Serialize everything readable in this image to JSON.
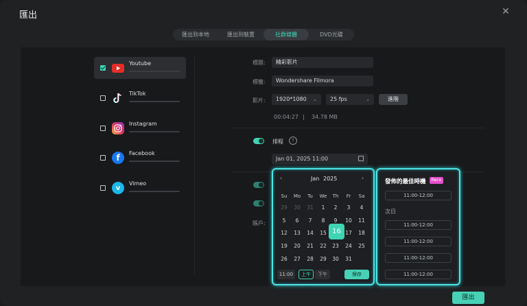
{
  "dialog": {
    "title": "匯出"
  },
  "tabs": [
    {
      "label": "匯出到本地"
    },
    {
      "label": "匯出到裝置"
    },
    {
      "label": "社群媒體"
    },
    {
      "label": "DVD光碟"
    }
  ],
  "platforms": [
    {
      "name": "Youtube",
      "checked": true,
      "icon": "youtube-icon",
      "color": "#e52d27"
    },
    {
      "name": "TikTok",
      "checked": false,
      "icon": "tiktok-icon",
      "color": "#ffffff"
    },
    {
      "name": "Instagram",
      "checked": false,
      "icon": "instagram-icon",
      "color": "#e1306c"
    },
    {
      "name": "Facebook",
      "checked": false,
      "icon": "facebook-icon",
      "color": "#1877f2"
    },
    {
      "name": "Vimeo",
      "checked": false,
      "icon": "vimeo-icon",
      "color": "#1ab7ea"
    }
  ],
  "form": {
    "title_label": "標題:",
    "title_value": "精彩影片",
    "tags_label": "標籤:",
    "tags_value": "Wondershare Filmora",
    "video_label": "影片:",
    "resolution": "1920*1080",
    "fps": "25 fps",
    "advanced": "進階",
    "duration": "00:04:27",
    "separator": "|",
    "size": "34.78 MB",
    "schedule_label": "排程",
    "datetime": "Jan 01, 2025  11:00",
    "account_label": "賬戶:"
  },
  "calendar": {
    "month": "Jan",
    "year": "2025",
    "weekdays": [
      "Su",
      "Mo",
      "Tu",
      "We",
      "Th",
      "Fr",
      "Sa"
    ],
    "rows": [
      [
        "29",
        "30",
        "31",
        "1",
        "2",
        "3",
        "4"
      ],
      [
        "5",
        "6",
        "7",
        "8",
        "9",
        "10",
        "11"
      ],
      [
        "12",
        "13",
        "14",
        "15",
        "16",
        "17",
        "18"
      ],
      [
        "19",
        "20",
        "21",
        "22",
        "23",
        "24",
        "25"
      ],
      [
        "26",
        "27",
        "28",
        "29",
        "30",
        "31",
        ""
      ]
    ],
    "selected": "16",
    "time": "11:00",
    "am": "上午",
    "pm": "下午",
    "save": "保存"
  },
  "best_times": {
    "title": "發佈的最佳時機",
    "badge": "Reco",
    "today_slot": "11:00-12:00",
    "next_day_label": "次日",
    "next_slots": [
      "11:00-12:00",
      "11:00-12:00",
      "11:00-12:00",
      "11:00-12:00"
    ]
  },
  "footer": {
    "export": "匯出"
  },
  "colors": {
    "accent": "#3fd4b4",
    "glow": "#4ee4e6",
    "reco": "#e24fc9"
  }
}
